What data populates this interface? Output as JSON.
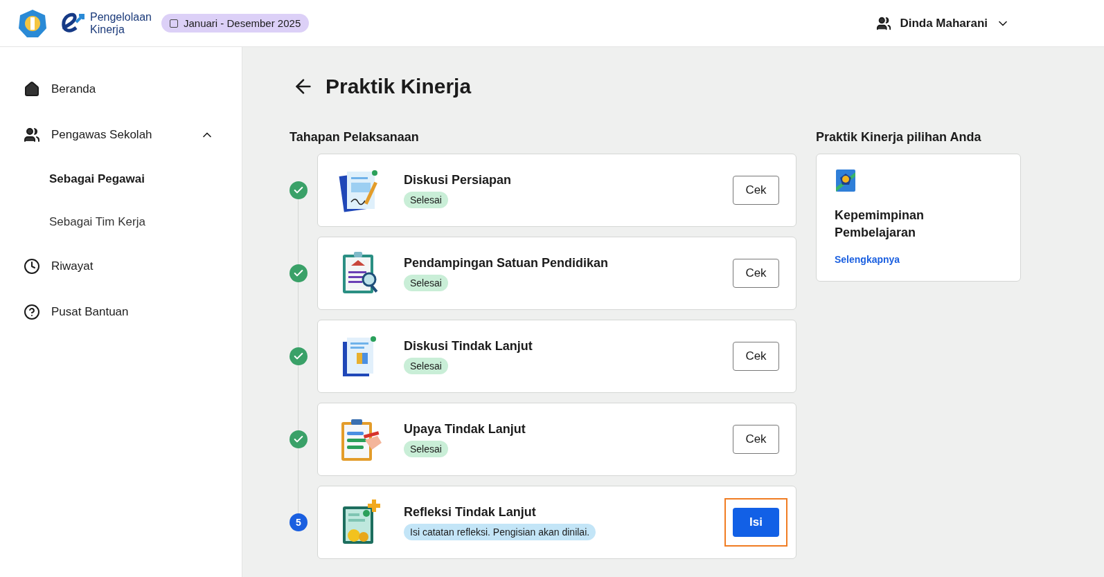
{
  "header": {
    "app_name": [
      "Pengelolaan",
      "Kinerja"
    ],
    "period": "Januari - Desember 2025",
    "user": "Dinda Maharani"
  },
  "sidebar": {
    "items": [
      {
        "label": "Beranda",
        "selected": false
      },
      {
        "label": "Pengawas Sekolah",
        "selected": false,
        "expanded": true,
        "children": [
          {
            "label": "Sebagai Pegawai",
            "selected": true
          },
          {
            "label": "Sebagai Tim Kerja",
            "selected": false
          }
        ]
      },
      {
        "label": "Riwayat",
        "selected": false
      },
      {
        "label": "Pusat Bantuan",
        "selected": false
      }
    ]
  },
  "page": {
    "title": "Praktik Kinerja"
  },
  "steps_section": {
    "heading": "Tahapan Pelaksanaan",
    "steps": [
      {
        "title": "Diskusi Persiapan",
        "done": true,
        "badge": "Selesai",
        "button": "Cek",
        "highlighted": false
      },
      {
        "title": "Pendampingan Satuan Pendidikan",
        "done": true,
        "badge": "Selesai",
        "button": "Cek",
        "highlighted": false
      },
      {
        "title": "Diskusi Tindak Lanjut",
        "done": true,
        "badge": "Selesai",
        "button": "Cek",
        "highlighted": false
      },
      {
        "title": "Upaya Tindak Lanjut",
        "done": true,
        "badge": "Selesai",
        "button": "Cek",
        "highlighted": false
      },
      {
        "title": "Refleksi Tindak Lanjut",
        "done": false,
        "number": "5",
        "badge": "Isi catatan refleksi. Pengisian akan dinilai.",
        "button": "Isi",
        "highlighted": true
      }
    ]
  },
  "choice_section": {
    "heading": "Praktik Kinerja pilihan Anda",
    "card": {
      "title": "Kepemimpinan Pembelajaran",
      "link": "Selengkapnya"
    }
  }
}
